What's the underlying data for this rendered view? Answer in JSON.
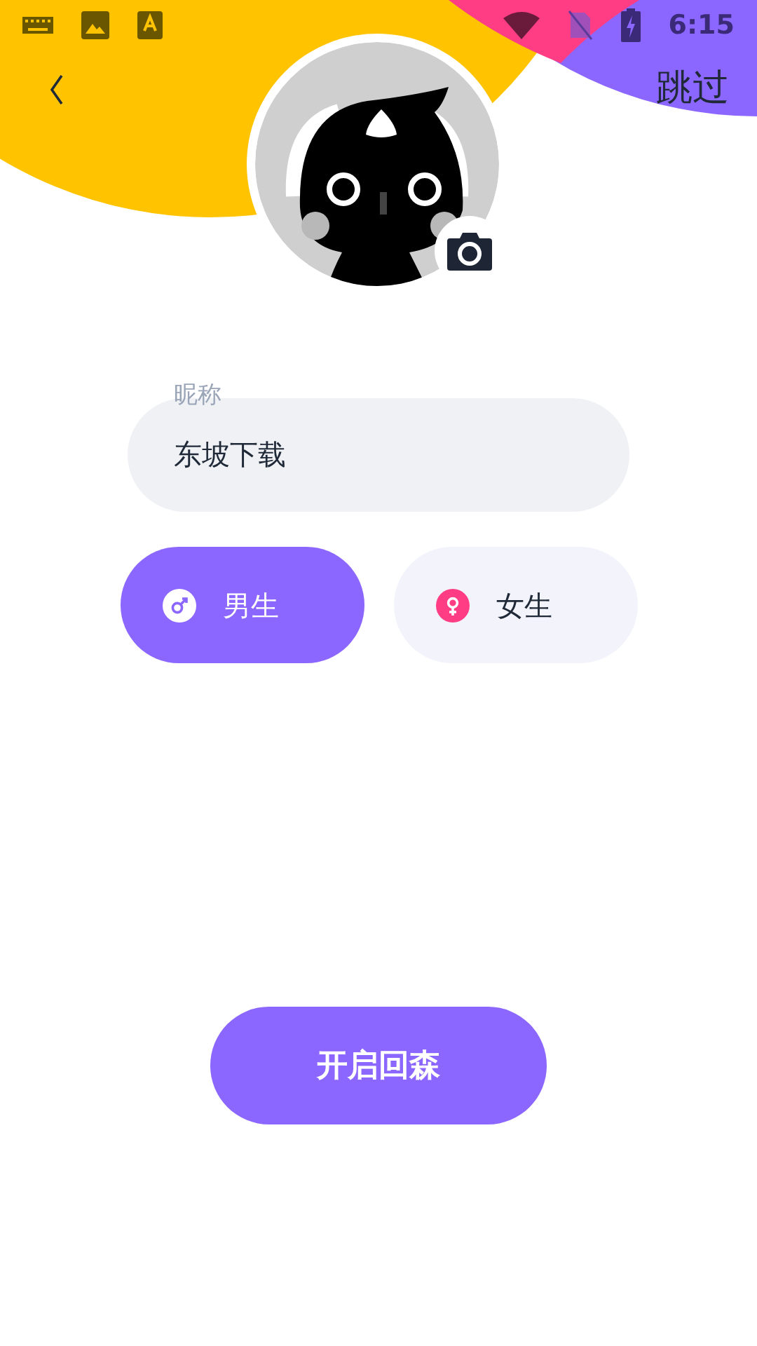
{
  "status_bar": {
    "time": "6:15"
  },
  "header": {
    "skip": "跳过"
  },
  "nickname": {
    "label": "昵称",
    "value": "东坡下载"
  },
  "genders": [
    {
      "kind": "male",
      "label": "男生",
      "selected": true
    },
    {
      "kind": "female",
      "label": "女生",
      "selected": false
    }
  ],
  "start_button": "开启回森"
}
